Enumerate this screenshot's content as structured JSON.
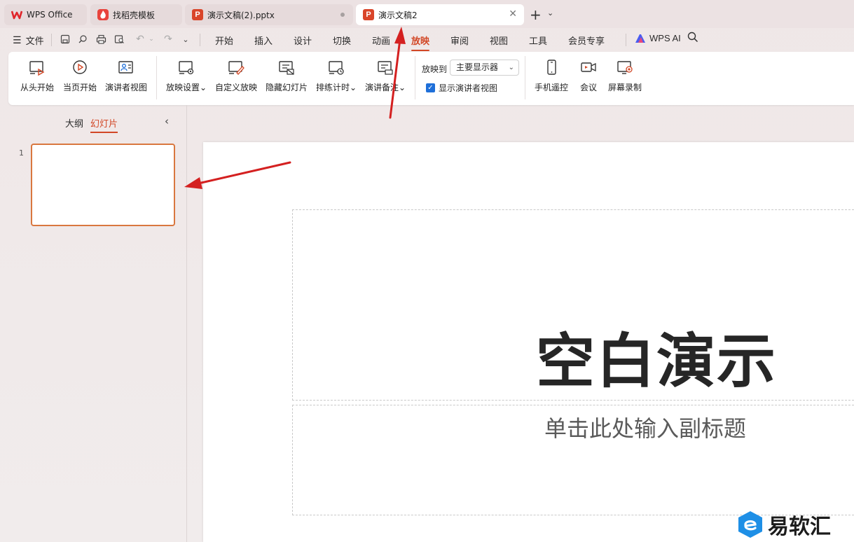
{
  "tabs": [
    {
      "label": "WPS Office",
      "icon": "wps-logo-icon"
    },
    {
      "label": "找稻壳模板",
      "icon": "docer-icon"
    },
    {
      "label": "演示文稿(2).pptx",
      "icon": "ppt-file-icon"
    },
    {
      "label": "演示文稿2",
      "icon": "ppt-file-icon",
      "active": true
    }
  ],
  "menu": {
    "file_label": "文件",
    "tabs": [
      "开始",
      "插入",
      "设计",
      "切换",
      "动画",
      "放映",
      "审阅",
      "视图",
      "工具",
      "会员专享"
    ],
    "active_tab": "放映",
    "ai_label": "WPS AI"
  },
  "ribbon": {
    "from_start": "从头开始",
    "from_current": "当页开始",
    "presenter_view": "演讲者视图",
    "show_settings": "放映设置",
    "custom_show": "自定义放映",
    "hide_slide": "隐藏幻灯片",
    "rehearse": "排练计时",
    "speaker_notes": "演讲备注",
    "show_to_label": "放映到",
    "show_to_value": "主要显示器",
    "show_presenter_check": "显示演讲者视图",
    "show_presenter_checked": true,
    "phone_remote": "手机遥控",
    "meeting": "会议",
    "screen_record": "屏幕录制"
  },
  "pane": {
    "outline_tab": "大纲",
    "slides_tab": "幻灯片",
    "slide_numbers": [
      "1"
    ]
  },
  "slide": {
    "title": "空白演示",
    "subtitle": "单击此处输入副标题"
  },
  "watermark": "易软汇",
  "colors": {
    "accent": "#d24726",
    "annotation_arrow": "#d42020",
    "checkbox": "#1e6fd9"
  }
}
